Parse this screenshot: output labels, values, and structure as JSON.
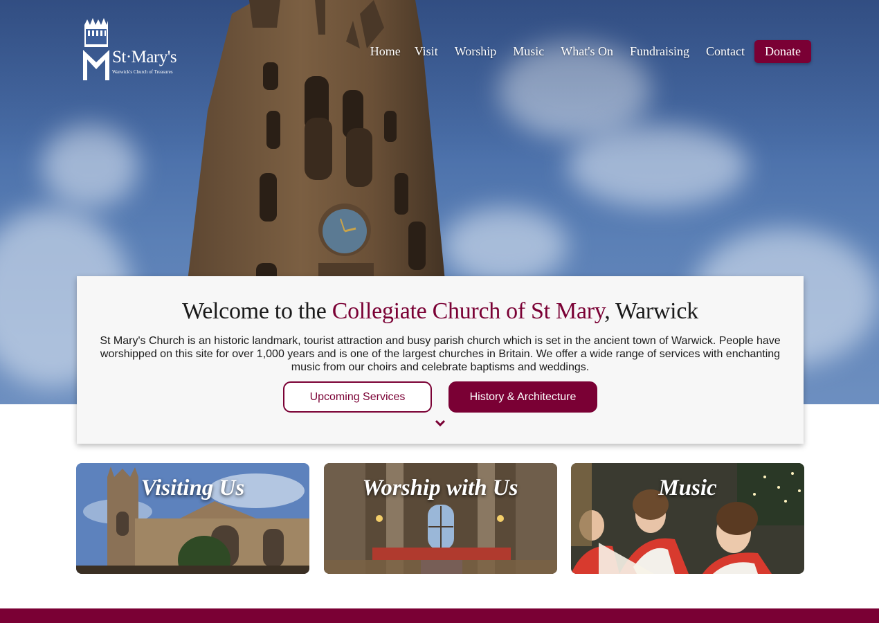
{
  "brand": {
    "name": "St·Mary's",
    "tagline": "Warwick's Church of Treasures"
  },
  "nav": {
    "items": [
      "Home",
      "Visit",
      "Worship",
      "Music",
      "What's On",
      "Fundraising",
      "Contact"
    ],
    "donate_label": "Donate"
  },
  "welcome": {
    "title_prefix": "Welcome to the ",
    "title_accent": "Collegiate Church of St Mary",
    "title_suffix": ", Warwick",
    "body": "St Mary's Church is an historic landmark, tourist attraction and busy parish church which is set in the ancient town of Warwick. People have worshipped on this site for over 1,000 years and is one of the largest churches in Britain. We offer a wide range of services with enchanting music from our choirs and celebrate baptisms and weddings.",
    "button_primary": "Upcoming Services",
    "button_secondary": "History & Architecture"
  },
  "cards": [
    {
      "title": "Visiting Us"
    },
    {
      "title": "Worship with Us"
    },
    {
      "title": "Music"
    }
  ],
  "colors": {
    "accent": "#7a0034",
    "sky": "#4a6fa9",
    "card_bg": "#f7f7f7"
  },
  "icons": {
    "scroll": "chevron-down-icon",
    "logo": "church-tower-logo-icon"
  }
}
